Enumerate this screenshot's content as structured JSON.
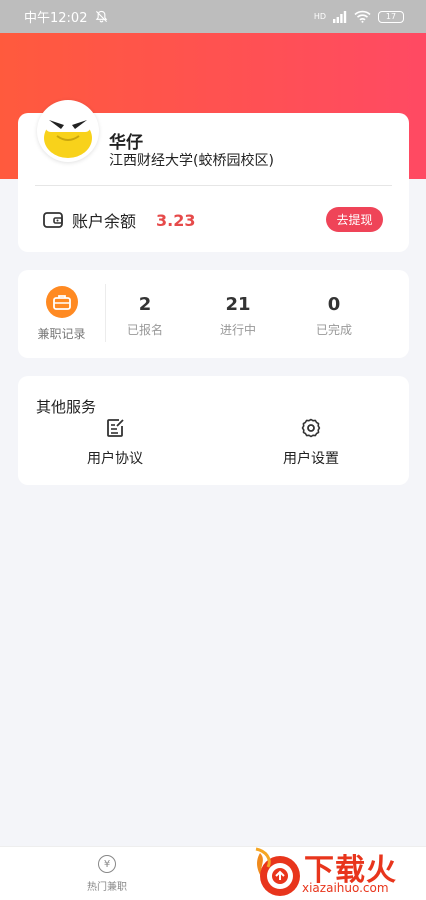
{
  "status_bar": {
    "time": "中午12:02",
    "signal": "HD",
    "battery": "17"
  },
  "profile": {
    "name": "华仔",
    "school": "江西财经大学(蛟桥园校区)",
    "balance_label": "账户余额",
    "balance_value": "3.23",
    "withdraw_label": "去提现"
  },
  "stats": {
    "record_label": "兼职记录",
    "items": [
      {
        "value": "2",
        "label": "已报名"
      },
      {
        "value": "21",
        "label": "进行中"
      },
      {
        "value": "0",
        "label": "已完成"
      }
    ]
  },
  "services": {
    "title": "其他服务",
    "items": [
      {
        "label": "用户协议",
        "icon": "document-edit-icon"
      },
      {
        "label": "用户设置",
        "icon": "gear-icon"
      }
    ]
  },
  "tab_bar": {
    "items": [
      {
        "label": "热门兼职",
        "icon": "yen-icon",
        "glyph": "¥"
      }
    ]
  },
  "watermark": {
    "text_cn": "下载火",
    "text_en": "xiazaihuo.com"
  },
  "colors": {
    "gradient_start": "#ff5a3d",
    "gradient_end": "#ff4a63",
    "accent_red": "#ef4458",
    "balance_red": "#e64a4a",
    "record_orange": "#ff8a22"
  }
}
